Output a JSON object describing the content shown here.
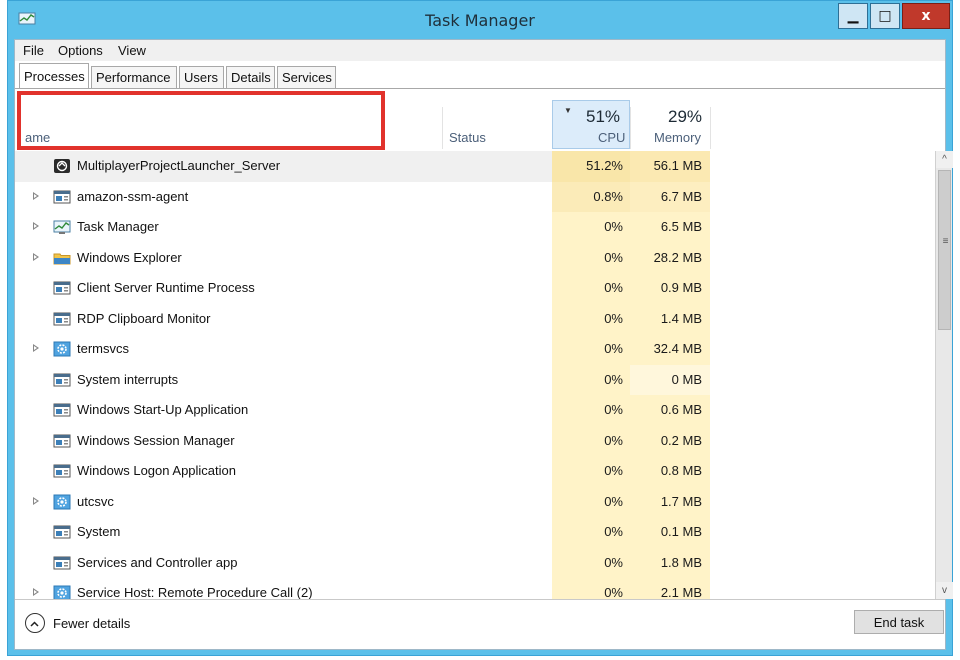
{
  "window": {
    "title": "Task Manager",
    "minimize_label": "▁",
    "maximize_label": "□",
    "close_label": "x"
  },
  "menubar": [
    "File",
    "Options",
    "View"
  ],
  "tabs": [
    "Processes",
    "Performance",
    "Users",
    "Details",
    "Services"
  ],
  "columns": {
    "name": "ame",
    "status": "Status",
    "cpu_pct": "51%",
    "cpu": "CPU",
    "mem_pct": "29%",
    "memory": "Memory"
  },
  "processes": [
    {
      "name": "MultiplayerProjectLauncher_Server",
      "cpu": "51.2%",
      "mem": "56.1 MB",
      "icon": "launcher-icon",
      "expandable": false
    },
    {
      "name": "amazon-ssm-agent",
      "cpu": "0.8%",
      "mem": "6.7 MB",
      "icon": "app-window-icon",
      "expandable": true
    },
    {
      "name": "Task Manager",
      "cpu": "0%",
      "mem": "6.5 MB",
      "icon": "task-manager-icon",
      "expandable": true
    },
    {
      "name": "Windows Explorer",
      "cpu": "0%",
      "mem": "28.2 MB",
      "icon": "folder-icon",
      "expandable": true
    },
    {
      "name": "Client Server Runtime Process",
      "cpu": "0%",
      "mem": "0.9 MB",
      "icon": "app-window-icon",
      "expandable": false
    },
    {
      "name": "RDP Clipboard Monitor",
      "cpu": "0%",
      "mem": "1.4 MB",
      "icon": "app-window-icon",
      "expandable": false
    },
    {
      "name": "termsvcs",
      "cpu": "0%",
      "mem": "32.4 MB",
      "icon": "gear-icon",
      "expandable": true
    },
    {
      "name": "System interrupts",
      "cpu": "0%",
      "mem": "0 MB",
      "icon": "app-window-icon",
      "expandable": false
    },
    {
      "name": "Windows Start-Up Application",
      "cpu": "0%",
      "mem": "0.6 MB",
      "icon": "app-window-icon",
      "expandable": false
    },
    {
      "name": "Windows Session Manager",
      "cpu": "0%",
      "mem": "0.2 MB",
      "icon": "app-window-icon",
      "expandable": false
    },
    {
      "name": "Windows Logon Application",
      "cpu": "0%",
      "mem": "0.8 MB",
      "icon": "app-window-icon",
      "expandable": false
    },
    {
      "name": "utcsvc",
      "cpu": "0%",
      "mem": "1.7 MB",
      "icon": "gear-icon",
      "expandable": true
    },
    {
      "name": "System",
      "cpu": "0%",
      "mem": "0.1 MB",
      "icon": "app-window-icon",
      "expandable": false
    },
    {
      "name": "Services and Controller app",
      "cpu": "0%",
      "mem": "1.8 MB",
      "icon": "app-window-icon",
      "expandable": false
    },
    {
      "name": "Service Host: Remote Procedure Call (2)",
      "cpu": "0%",
      "mem": "2.1 MB",
      "icon": "gear-icon",
      "expandable": true
    }
  ],
  "footer": {
    "fewer_details": "Fewer details",
    "end_task": "End task"
  },
  "colors": {
    "titlebar": "#5bc0ea",
    "highlight": "#e1322c",
    "cpu_heat": "#f9e6a9"
  }
}
